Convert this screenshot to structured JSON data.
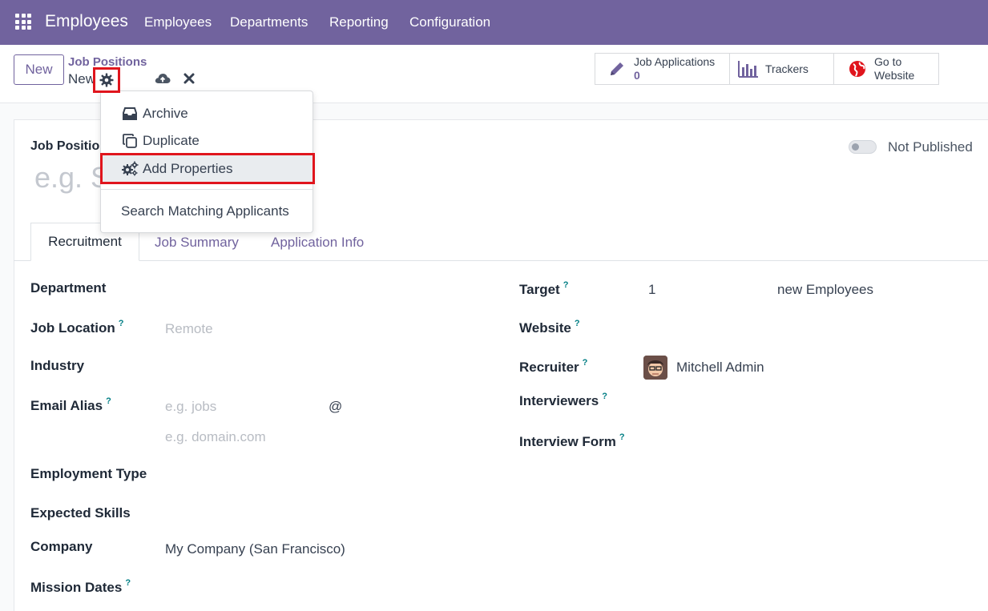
{
  "navbar": {
    "brand": "Employees",
    "menu": [
      "Employees",
      "Departments",
      "Reporting",
      "Configuration"
    ]
  },
  "control": {
    "new_label": "New",
    "breadcrumb_parent": "Job Positions",
    "breadcrumb_current": "New",
    "stats": {
      "job_applications_label": "Job Applications",
      "job_applications_count": "0",
      "trackers_label": "Trackers",
      "website_line1": "Go to",
      "website_line2": "Website"
    }
  },
  "form": {
    "job_position_label": "Job Positio",
    "job_position_placeholder": "e.g. S",
    "publish_label": "Not Published",
    "tabs": [
      "Recruitment",
      "Job Summary",
      "Application Info"
    ],
    "left_fields": {
      "department": "Department",
      "job_location": "Job Location",
      "job_location_placeholder": "Remote",
      "industry": "Industry",
      "email_alias": "Email Alias",
      "email_alias_placeholder": "e.g. jobs",
      "email_at": "@",
      "email_domain_placeholder": "e.g. domain.com",
      "employment_type": "Employment Type",
      "expected_skills": "Expected Skills",
      "company": "Company",
      "company_value": "My Company (San Francisco)",
      "mission_dates": "Mission Dates"
    },
    "right_fields": {
      "target": "Target",
      "target_value": "1",
      "target_unit": "new Employees",
      "website": "Website",
      "recruiter": "Recruiter",
      "recruiter_value": "Mitchell Admin",
      "interviewers": "Interviewers",
      "interview_form": "Interview Form"
    },
    "help_mark": "?"
  },
  "dropdown": {
    "archive": "Archive",
    "duplicate": "Duplicate",
    "add_properties": "Add Properties",
    "search_matching": "Search Matching Applicants"
  },
  "colors": {
    "brand": "#71639e",
    "highlight": "#e0151d",
    "help": "#017e84"
  }
}
